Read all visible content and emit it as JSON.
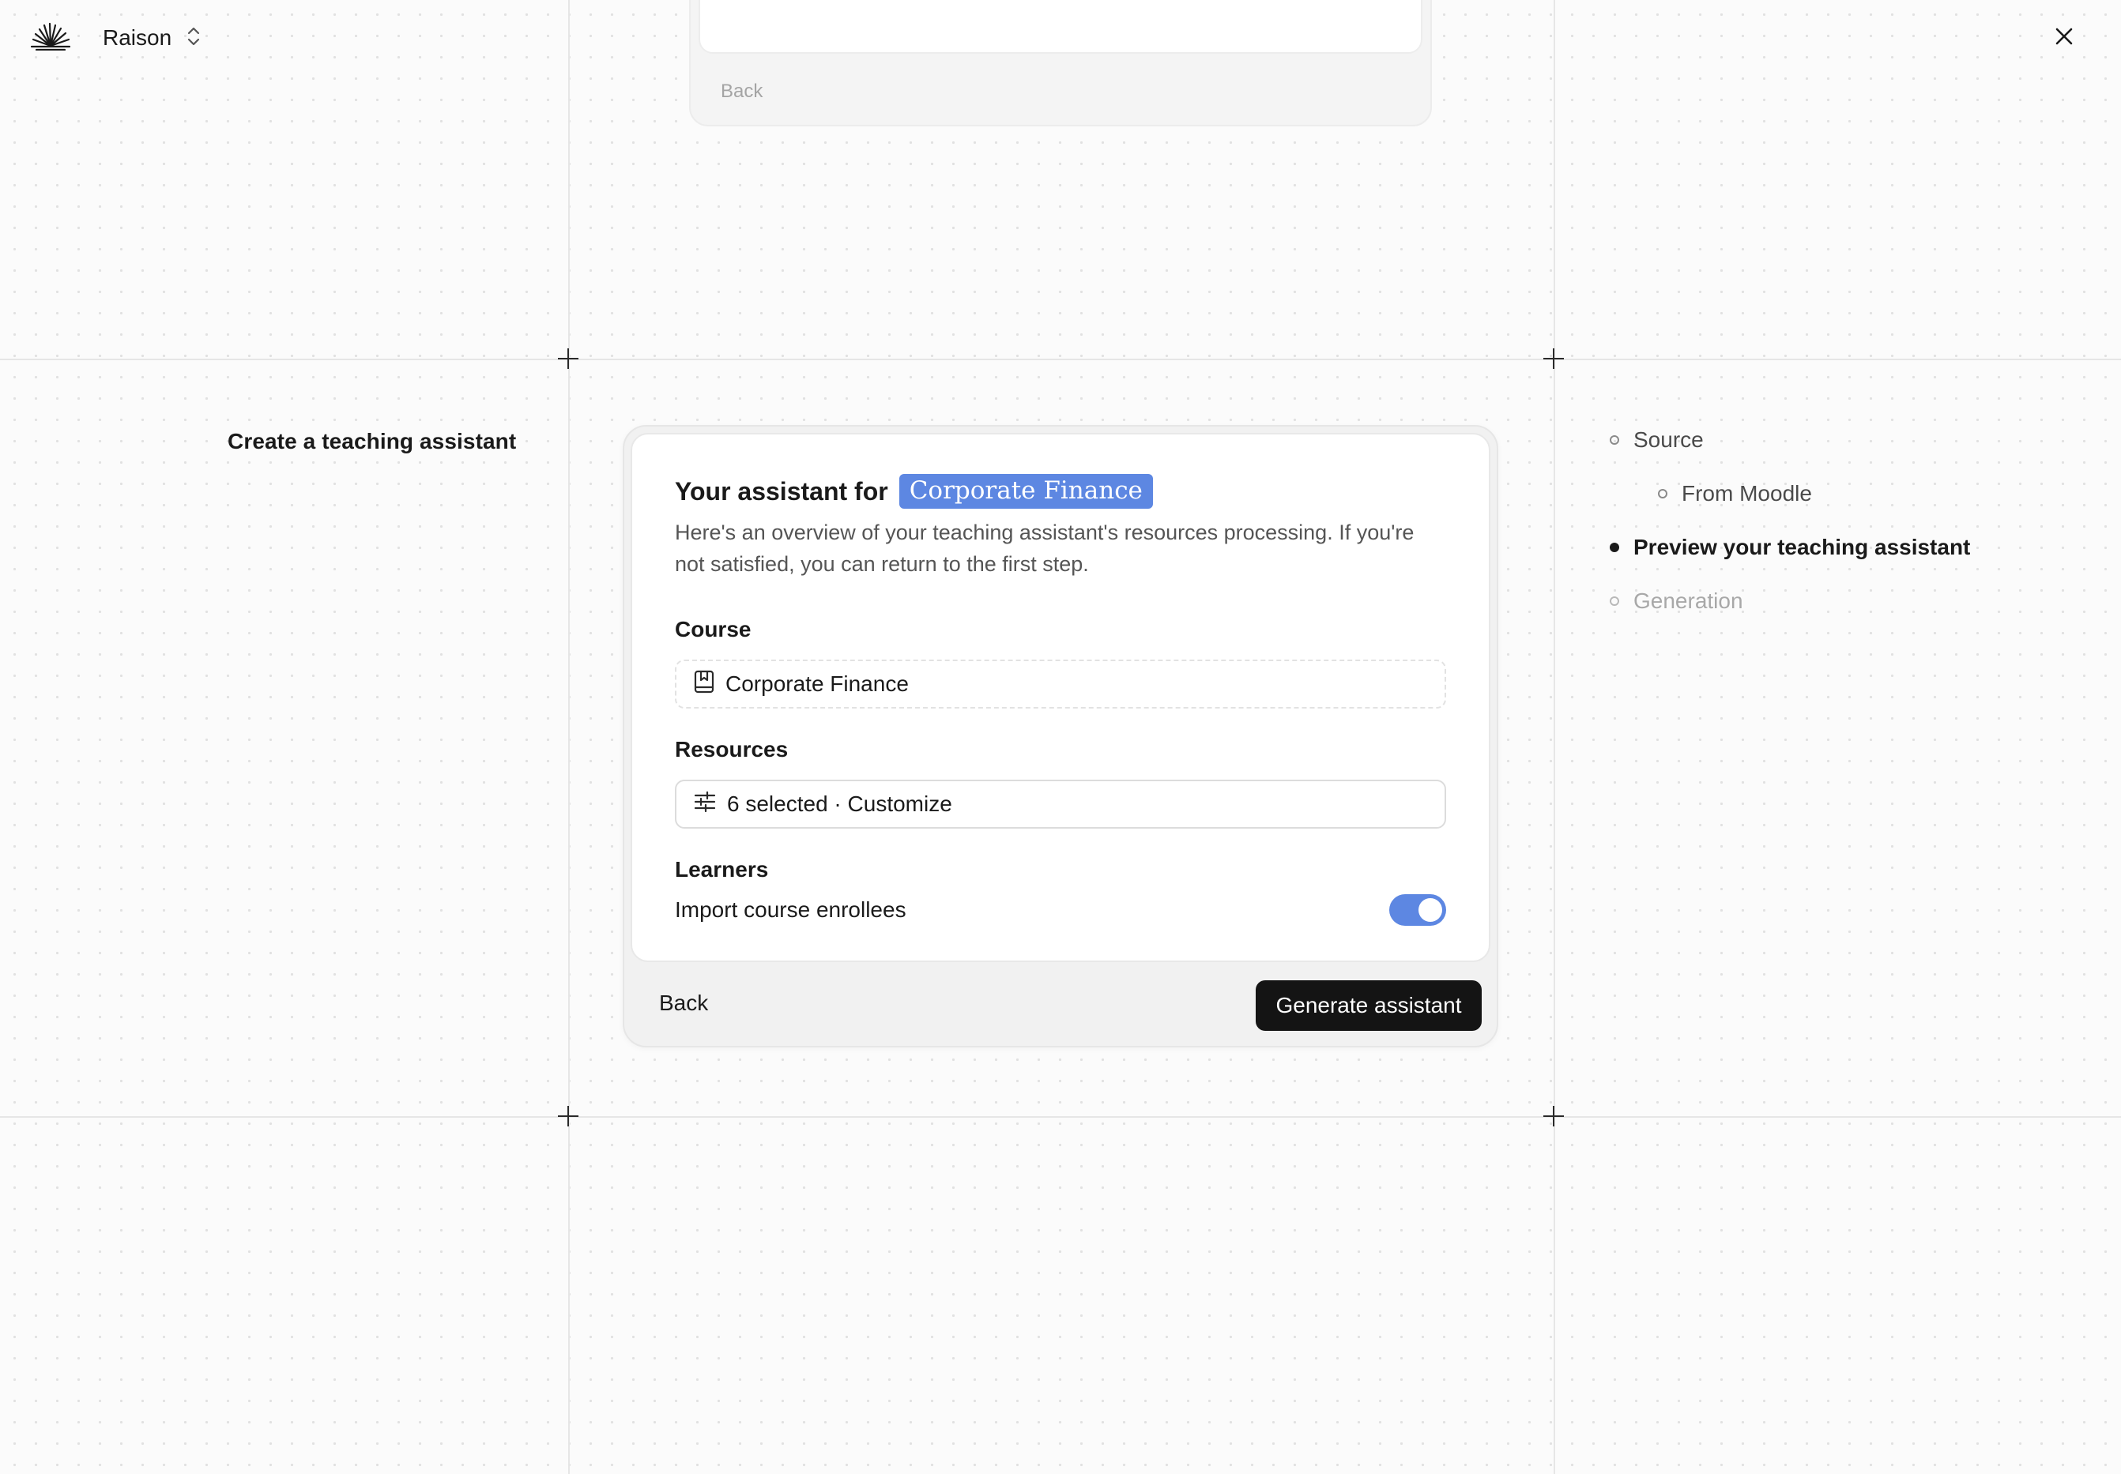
{
  "header": {
    "workspace_name": "Raison"
  },
  "previous_card": {
    "back_label": "Back"
  },
  "page": {
    "title": "Create a teaching assistant"
  },
  "card": {
    "heading_prefix": "Your assistant for",
    "course_chip": "Corporate Finance",
    "description": "Here's an overview of your teaching assistant's resources processing. If you're not satisfied, you can return to the first step.",
    "course": {
      "label": "Course",
      "value": "Corporate Finance"
    },
    "resources": {
      "label": "Resources",
      "value": "6 selected · Customize"
    },
    "learners": {
      "label": "Learners",
      "toggle_label": "Import course enrollees",
      "toggle_on": true
    },
    "back_label": "Back",
    "generate_label": "Generate assistant"
  },
  "steps": [
    {
      "label": "Source",
      "state": "done"
    },
    {
      "label": "From Moodle",
      "state": "done"
    },
    {
      "label": "Preview your teaching assistant",
      "state": "current"
    },
    {
      "label": "Generation",
      "state": "upcoming"
    }
  ],
  "colors": {
    "accent": "#5d87e2",
    "primary_button": "#141414",
    "canvas": "#fbfbfb"
  }
}
